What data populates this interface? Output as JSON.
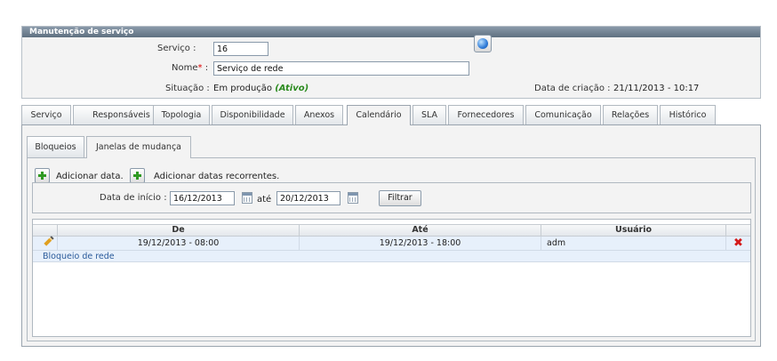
{
  "panel": {
    "title": "Manutenção de serviço",
    "servico_label": "Serviço :",
    "servico_value": "16",
    "nome_label": "Nome",
    "nome_required": "*",
    "nome_colon": ":",
    "nome_value": "Serviço de rede",
    "situacao_label": "Situação :",
    "situacao_value": "Em produção",
    "situacao_status": "(Ativo)",
    "data_criacao_label": "Data de criação :",
    "data_criacao_value": "21/11/2013 - 10:17"
  },
  "tabs": [
    {
      "label": "Serviço"
    },
    {
      "label": "Responsáveis"
    },
    {
      "label": "Topologia"
    },
    {
      "label": "Disponibilidade"
    },
    {
      "label": "Anexos"
    },
    {
      "label": "Calendário"
    },
    {
      "label": "SLA"
    },
    {
      "label": "Fornecedores"
    },
    {
      "label": "Comunicação"
    },
    {
      "label": "Relações"
    },
    {
      "label": "Histórico"
    }
  ],
  "active_tab": "Calendário",
  "subtabs": [
    {
      "label": "Bloqueios"
    },
    {
      "label": "Janelas de mudança"
    }
  ],
  "active_subtab": "Janelas de mudança",
  "actions": {
    "add_date": "Adicionar data.",
    "add_recurring": "Adicionar datas recorrentes."
  },
  "filter": {
    "start_label": "Data de início :",
    "start_value": "16/12/2013",
    "until_label": "até",
    "end_value": "20/12/2013",
    "button_label": "Filtrar"
  },
  "grid": {
    "columns": [
      "De",
      "Até",
      "Usuário"
    ],
    "rows": [
      {
        "de": "19/12/2013 - 08:00",
        "ate": "19/12/2013 - 18:00",
        "usuario": "adm",
        "description": "Bloqueio de rede"
      }
    ]
  },
  "icons": {
    "globe": "globe-icon",
    "add": "plus-icon",
    "calendar": "calendar-icon",
    "edit": "pencil-icon",
    "delete": "delete-x-icon"
  },
  "colors": {
    "title_bar": "#6f7f8f",
    "active_status": "#2a8a1e",
    "required": "#dd0000",
    "row_highlight": "#e7f0fb",
    "link": "#2a5a9a",
    "delete": "#d41a1a"
  }
}
